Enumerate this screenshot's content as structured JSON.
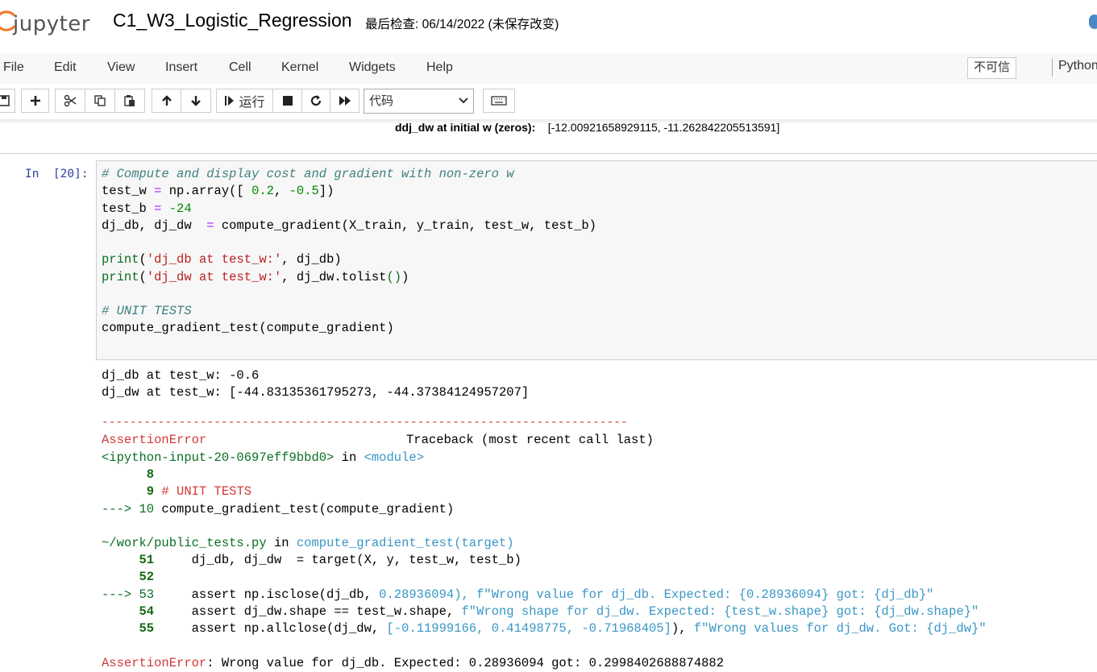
{
  "header": {
    "logo_text": "jupyter",
    "notebook_title": "C1_W3_Logistic_Regression",
    "checkpoint": "最后检查: 06/14/2022  (未保存改变)"
  },
  "menu": {
    "items": [
      "File",
      "Edit",
      "View",
      "Insert",
      "Cell",
      "Kernel",
      "Widgets",
      "Help"
    ],
    "trust_label": "不可信",
    "kernel_name": "Python"
  },
  "toolbar": {
    "run_label": "运行",
    "cell_type": "代码",
    "icons": [
      "save-icon",
      "plus-icon",
      "cut-icon",
      "copy-icon",
      "paste-icon",
      "arrow-up-icon",
      "arrow-down-icon",
      "run-icon",
      "stop-icon",
      "restart-icon",
      "fast-forward-icon",
      "keyboard-icon"
    ]
  },
  "previous_output": {
    "label": "ddj_dw at initial w (zeros):",
    "value": "[-12.00921658929115, -11.262842205513591]"
  },
  "cell": {
    "prompt": "In  [20]:",
    "code": {
      "l1": "# Compute and display cost and gradient with non-zero w",
      "l2a": "test_w ",
      "l2b": "=",
      "l2c": " np.array([ ",
      "l2d": "0.2",
      "l2e": ", ",
      "l2f": "-0.5",
      "l2g": "])",
      "l3a": "test_b ",
      "l3b": "=",
      "l3c": " ",
      "l3d": "-24",
      "l4a": "dj_db, dj_dw  ",
      "l4b": "=",
      "l4c": " compute_gradient(X_train, y_train, test_w, test_b)",
      "l5a": "print",
      "l5b": "(",
      "l5c": "'dj_db at test_w:'",
      "l5d": ", dj_db)",
      "l6a": "print",
      "l6b": "(",
      "l6c": "'dj_dw at test_w:'",
      "l6d": ", dj_dw.tolist",
      "l6e": "()",
      "l6f": ")",
      "l7": "# UNIT TESTS",
      "l8": "compute_gradient_test(compute_gradient)"
    }
  },
  "output": {
    "o1": "dj_db at test_w: -0.6",
    "o2": "dj_dw at test_w: [-44.83135361795273, -44.37384124957207]",
    "rule": "---------------------------------------------------------------------------",
    "err_name": "AssertionError",
    "traceback_label": "Traceback (most recent call last)",
    "t1a": "<ipython-input-20-0697eff9bbd0>",
    "t1b": " in ",
    "t1c": "<module>",
    "t2": "      8",
    "t3a": "      9",
    "t3b": " # UNIT TESTS",
    "t4a": "---> 10",
    "t4b": " compute_gradient_test(compute_gradient)",
    "t5a": "~/work/public_tests.py",
    "t5b": " in ",
    "t5c": "compute_gradient_test(target)",
    "t6a": "     51",
    "t6b": "     dj_db, dj_dw  = target(X, y, test_w, test_b)",
    "t7": "     52",
    "t8a": "---> 53",
    "t8b": "     assert np.isclose(dj_db, ",
    "t8c": "0.28936094",
    "t8d": "), f\"Wrong value for dj_db. Expected: {0.28936094} got: {dj_db}\"",
    "t9a": "     54",
    "t9b": "     assert dj_dw.shape == test_w.shape, ",
    "t9c": "f\"Wrong shape for dj_dw. Expected: {test_w.shape} got: {dj_dw.shape}\"",
    "t10a": "     55",
    "t10b": "     assert np.allclose(dj_dw, ",
    "t10c": "[-0.11999166, 0.41498775, -0.71968405]",
    "t10d": "), ",
    "t10e": "f\"Wrong values for dj_dw. Got: {dj_dw}\"",
    "final_a": "AssertionError",
    "final_b": ": Wrong value for dj_db. Expected: 0.28936094 got: 0.2998402688874882"
  }
}
